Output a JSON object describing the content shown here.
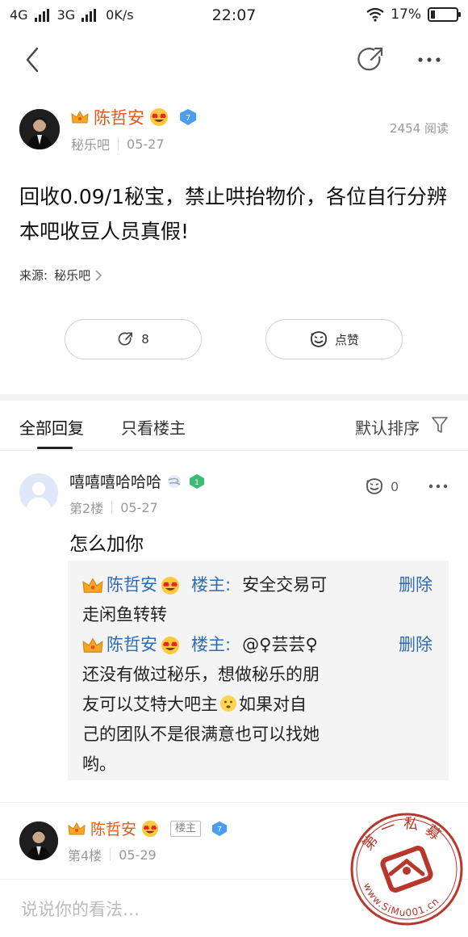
{
  "status_bar": {
    "network1": "4G",
    "network2": "3G",
    "speed": "0K/s",
    "time": "22:07",
    "battery": "17%",
    "battery_level": 0.17
  },
  "post": {
    "author": "陈哲安",
    "forum": "秘乐吧",
    "date": "05-27",
    "read_count": "2454 阅读",
    "title": "回收0.09/1秘宝，禁止哄抬物价，各位自行分辨本吧收豆人员真假!",
    "source_label": "来源:",
    "source_forum": "秘乐吧",
    "share_count": "8",
    "like_label": "点赞"
  },
  "tabs": {
    "all": "全部回复",
    "owner_only": "只看楼主",
    "sort": "默认排序"
  },
  "reply": {
    "name": "嘻嘻嘻哈哈哈",
    "floor": "第2楼",
    "date": "05-27",
    "like_count": "0",
    "text": "怎么加你",
    "sub_replies": [
      {
        "author": "陈哲安",
        "owner_label": "楼主:",
        "text_inline": "安全交易可",
        "text_rest": "走闲鱼转转",
        "delete": "删除"
      },
      {
        "author": "陈哲安",
        "owner_label": "楼主:",
        "text_inline": "@♀芸芸♀",
        "text_rest_1": "还没有做过秘乐，想做秘乐的朋",
        "text_rest_2": "友可以艾特大吧主",
        "text_rest_3": "如果对自",
        "text_rest_4": "己的团队不是很满意也可以找她",
        "text_rest_5": "哟。",
        "delete": "删除"
      }
    ]
  },
  "floor4": {
    "name": "陈哲安",
    "owner_tag": "楼主",
    "floor": "第4楼",
    "date": "05-29"
  },
  "input": {
    "placeholder": "说说你的看法…"
  },
  "watermark": {
    "top_text": "第一私募",
    "bottom_text": "www.SiMu001.cn"
  },
  "colors": {
    "accent_orange": "#e35a1c",
    "link_blue": "#2e6bb3",
    "gray_text": "#999999"
  }
}
